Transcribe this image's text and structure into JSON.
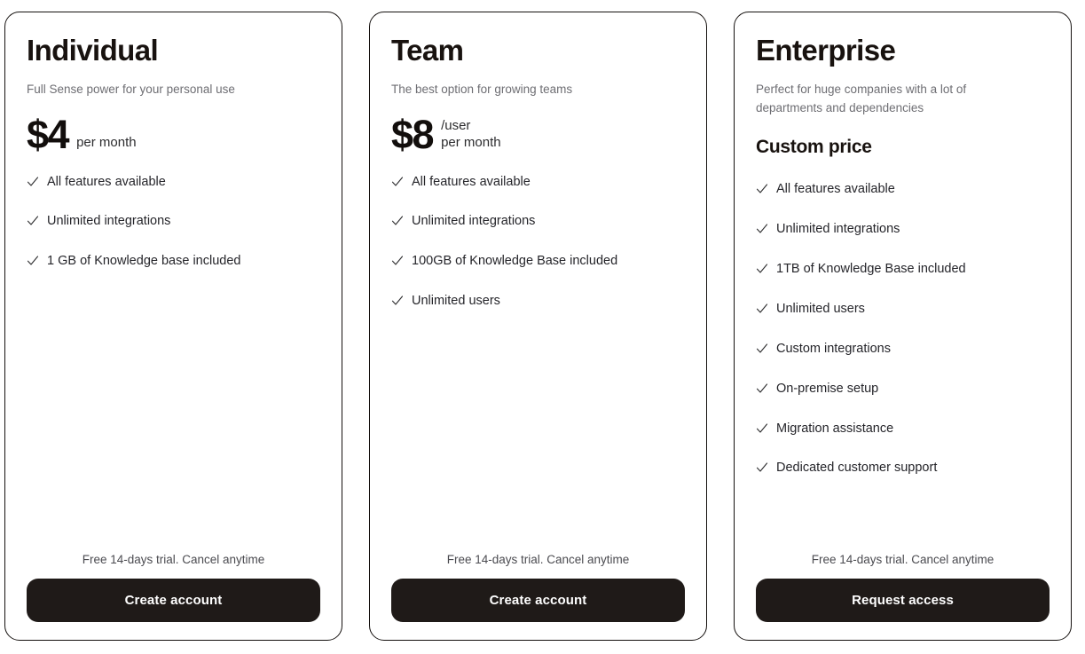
{
  "page": {
    "background_color": "#ffffff",
    "card_border_color": "#15110f",
    "button_color": "#1f1a18",
    "button_text_color": "#ffffff",
    "muted_text_color": "#6e6e73"
  },
  "plans": [
    {
      "title": "Individual",
      "subtitle": "Full Sense power for your personal use",
      "price_amount": "$4",
      "price_suffix_lines": [
        "per month"
      ],
      "features": [
        "All features available",
        "Unlimited integrations",
        "1 GB of Knowledge base included"
      ],
      "trial_note": "Free 14-days trial. Cancel anytime",
      "cta_label": "Create account"
    },
    {
      "title": "Team",
      "subtitle": "The best option for growing teams",
      "price_amount": "$8",
      "price_suffix_lines": [
        "/user",
        "per month"
      ],
      "features": [
        "All features available",
        "Unlimited integrations",
        "100GB of Knowledge Base included",
        "Unlimited users"
      ],
      "trial_note": "Free 14-days trial. Cancel anytime",
      "cta_label": "Create account"
    },
    {
      "title": "Enterprise",
      "subtitle": "Perfect for huge companies with a lot of departments and dependencies",
      "price_custom": "Custom price",
      "features": [
        "All features available",
        "Unlimited integrations",
        "1TB of Knowledge Base included",
        "Unlimited users",
        "Custom integrations",
        "On-premise setup",
        "Migration assistance",
        "Dedicated customer support"
      ],
      "trial_note": "Free 14-days trial. Cancel anytime",
      "cta_label": "Request access"
    }
  ],
  "icons": {
    "check": "check-icon"
  }
}
